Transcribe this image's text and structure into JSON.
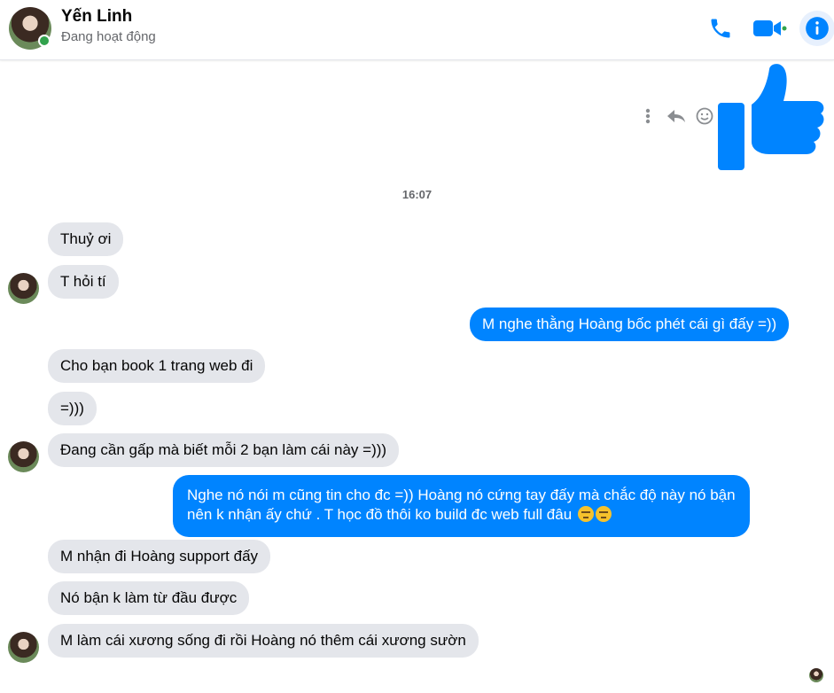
{
  "header": {
    "name": "Yến Linh",
    "status": "Đang hoạt động",
    "colors": {
      "accent": "#0084ff",
      "online": "#31a24c"
    },
    "icons": [
      "phone-icon",
      "video-call-icon",
      "info-icon"
    ]
  },
  "conversation": {
    "timestamp": "16:07",
    "like_actions": [
      "more-options-icon",
      "reply-icon",
      "react-icon"
    ],
    "messages": [
      {
        "side": "in",
        "text": "Thuỷ ơi"
      },
      {
        "side": "in",
        "text": "T hỏi tí"
      },
      {
        "side": "out",
        "text": "M nghe thằng Hoàng bốc phét cái gì đấy =))"
      },
      {
        "side": "in",
        "text": "Cho bạn book 1 trang web đi"
      },
      {
        "side": "in",
        "text": "=)))"
      },
      {
        "side": "in",
        "text": "Đang cần gấp mà biết mỗi 2 bạn làm cái này =)))"
      },
      {
        "side": "out",
        "line1": "Nghe nó nói m cũng tin cho đc =)) Hoàng nó cứng tay đấy mà chắc độ này nó bận",
        "line2": "nên k nhận ấy chứ . T học đồ thôi ko build đc web full đâu",
        "emoji": "unamused-face-emoji"
      },
      {
        "side": "in",
        "text": "M nhận đi Hoàng support đấy"
      },
      {
        "side": "in",
        "text": "Nó bận k làm từ đầu được"
      },
      {
        "side": "in",
        "text": "M làm cái xương sống đi rồi Hoàng nó thêm cái xương sườn"
      }
    ]
  }
}
